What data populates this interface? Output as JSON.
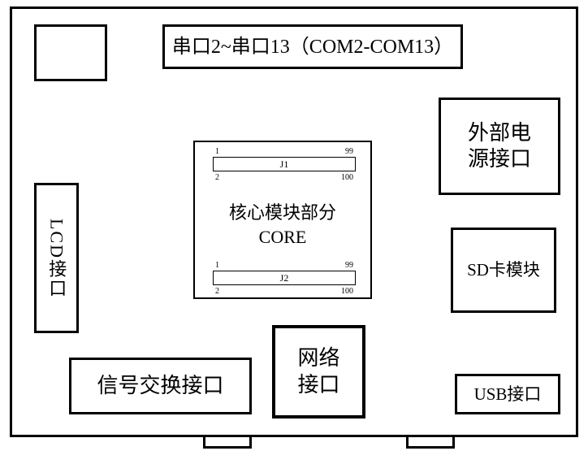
{
  "blocks": {
    "serial": "串口2~串口13（COM2-COM13）",
    "power": "外部电\n源接口",
    "sd": "SD卡模块",
    "lcd": "LCD接口",
    "signal": "信号交换接口",
    "network": "网络\n接口",
    "usb": "USB接口"
  },
  "core": {
    "title": "核心模块部分\nCORE",
    "j1": {
      "name": "J1",
      "tl": "1",
      "tr": "99",
      "bl": "2",
      "br": "100"
    },
    "j2": {
      "name": "J2",
      "tl": "1",
      "tr": "99",
      "bl": "2",
      "br": "100"
    }
  }
}
